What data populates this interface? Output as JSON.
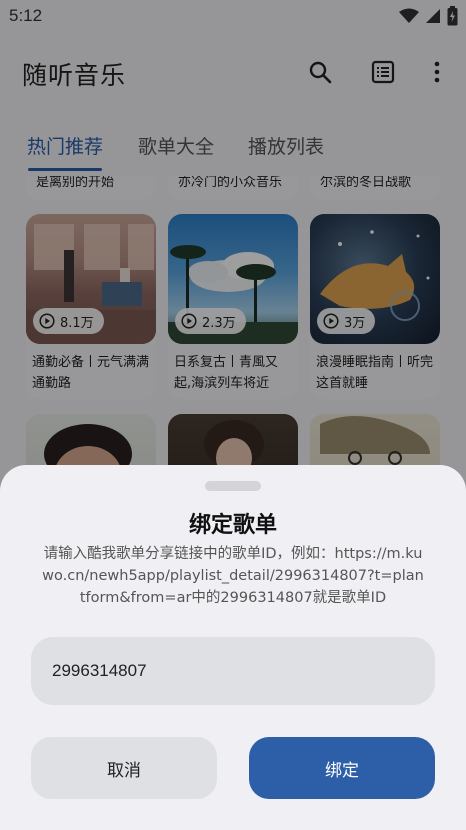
{
  "status_bar": {
    "time": "5:12"
  },
  "app_bar": {
    "title": "随听音乐",
    "icons": [
      "search-icon",
      "list-icon",
      "more-vert-icon"
    ]
  },
  "tabs": [
    {
      "label": "热门推荐",
      "active": true
    },
    {
      "label": "歌单大全",
      "active": false
    },
    {
      "label": "播放列表",
      "active": false
    }
  ],
  "top_row_titles": [
    "是离别的开始",
    "亦冷门的小众音乐",
    "尔滨的冬日战歌"
  ],
  "playlists": [
    {
      "title": "通勤必备丨元气满满通勤路",
      "plays": "8.1万"
    },
    {
      "title": "日系复古丨青風又起,海滨列车将近",
      "plays": "2.3万"
    },
    {
      "title": "浪漫睡眠指南丨听完这首就睡",
      "plays": "3万"
    }
  ],
  "dialog": {
    "title": "绑定歌单",
    "description": "请输入酷我歌单分享链接中的歌单ID，例如：https://m.kuwo.cn/newh5app/playlist_detail/2996314807?t=plantform&from=ar中的2996314807就是歌单ID",
    "input_value": "2996314807",
    "cancel_label": "取消",
    "confirm_label": "绑定"
  },
  "colors": {
    "accent": "#2d5fa8",
    "sheet_background": "#f0f0f4",
    "input_background": "#dfe0e4"
  }
}
